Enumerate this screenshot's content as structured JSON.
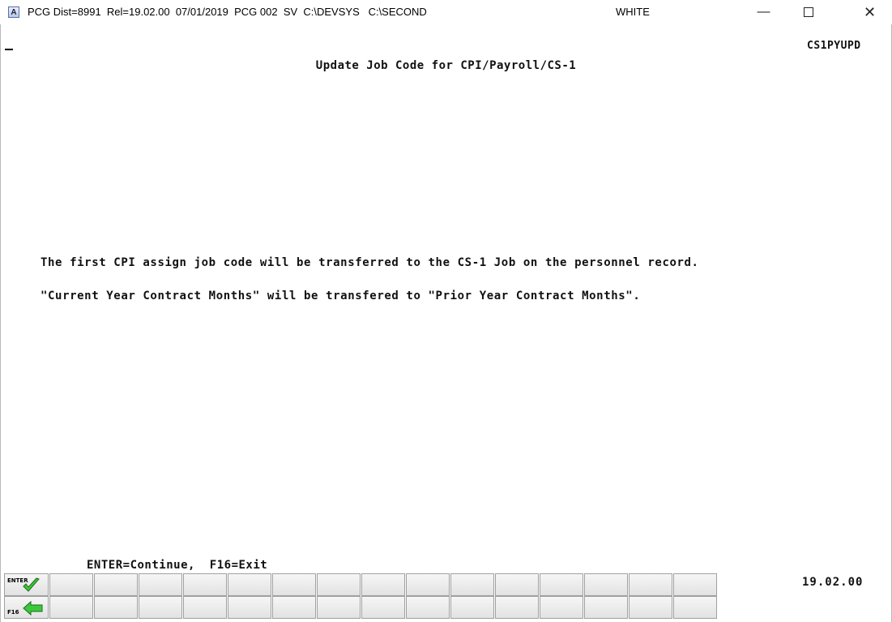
{
  "window": {
    "title": "PCG Dist=8991  Rel=19.02.00  07/01/2019  PCG 002  SV  C:\\DEVSYS   C:\\SECOND",
    "user": "WHITE",
    "icon": "A",
    "min_glyph": "—",
    "close_glyph": "✕"
  },
  "screen": {
    "program_id": "CS1PYUPD",
    "title": "Update Job Code for CPI/Payroll/CS-1",
    "messages": [
      "The first CPI assign job code will be transferred to the CS-1 Job on the personnel record.",
      "\"Current Year Contract Months\" will be transfered to \"Prior Year Contract Months\"."
    ],
    "key_legend": "ENTER=Continue,  F16=Exit",
    "version": "19.02.00"
  },
  "fkeys": {
    "enter_label": "ENTER",
    "f16_label": "F16",
    "colors": {
      "icon_green": "#3cc83c",
      "icon_outline": "#1a6d1a"
    }
  }
}
